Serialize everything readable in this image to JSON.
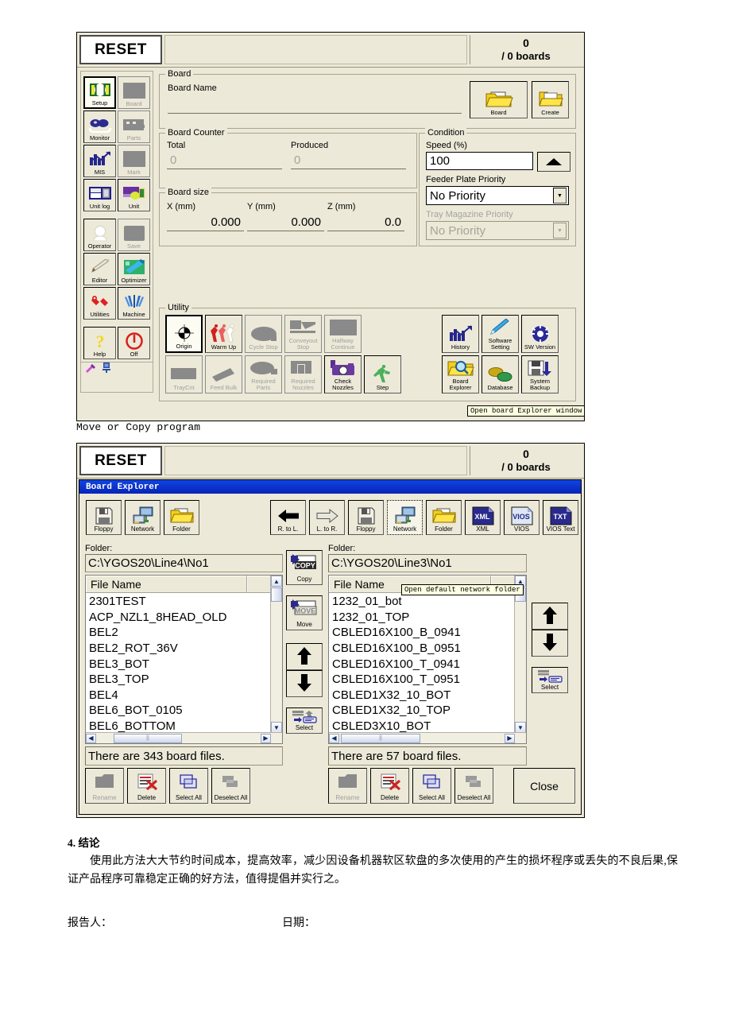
{
  "panel1": {
    "header": {
      "reset": "RESET",
      "count": "0",
      "boards": "/ 0 boards"
    },
    "nav": [
      {
        "label": "Setup",
        "icon": "setup-icon",
        "state": "selected"
      },
      {
        "label": "Board",
        "icon": "board-icon",
        "state": "disabled"
      },
      {
        "label": "Monitor",
        "icon": "monitor-icon",
        "state": "normal"
      },
      {
        "label": "Parts",
        "icon": "parts-icon",
        "state": "disabled"
      },
      {
        "label": "MIS",
        "icon": "mis-chart-icon",
        "state": "normal"
      },
      {
        "label": "Mark",
        "icon": "mark-icon",
        "state": "disabled"
      },
      {
        "label": "Unit log",
        "icon": "unit-log-icon",
        "state": "normal"
      },
      {
        "label": "Unit",
        "icon": "unit-icon",
        "state": "normal"
      },
      {
        "label": "Operator",
        "icon": "operator-icon",
        "state": "normal"
      },
      {
        "label": "Save",
        "icon": "save-icon",
        "state": "disabled"
      },
      {
        "label": "Editor",
        "icon": "editor-pencil-icon",
        "state": "normal"
      },
      {
        "label": "Optimizer",
        "icon": "optimizer-icon",
        "state": "normal"
      },
      {
        "label": "Utilities",
        "icon": "wrench-icon",
        "state": "normal"
      },
      {
        "label": "Machine",
        "icon": "machine-icon",
        "state": "normal"
      },
      {
        "label": "Help",
        "icon": "question-mark-icon",
        "state": "normal"
      },
      {
        "label": "Off",
        "icon": "power-off-icon",
        "state": "normal"
      }
    ],
    "board_group": {
      "caption": "Board",
      "name_label": "Board Name",
      "name_value": "",
      "board_button": "Board",
      "create_button": "Create"
    },
    "board_counter": {
      "caption": "Board Counter",
      "total_label": "Total",
      "total_value": "0",
      "produced_label": "Produced",
      "produced_value": "0"
    },
    "board_size": {
      "caption": "Board size",
      "x_label": "X (mm)",
      "x_value": "0.000",
      "y_label": "Y (mm)",
      "y_value": "0.000",
      "z_label": "Z (mm)",
      "z_value": "0.0"
    },
    "condition": {
      "caption": "Condition",
      "speed_label": "Speed (%)",
      "speed_value": "100",
      "feeder_label": "Feeder Plate Priority",
      "feeder_value": "No Priority",
      "tray_label": "Tray Magazine Priority",
      "tray_value": "No Priority"
    },
    "utility": {
      "caption": "Utility",
      "left_row1": [
        {
          "label": "Origin",
          "icon": "origin-target-icon",
          "state": "selected"
        },
        {
          "label": "Warm Up",
          "icon": "warm-up-runner-icon",
          "state": "normal"
        },
        {
          "label": "Cycle Stop",
          "icon": "cycle-stop-icon",
          "state": "disabled"
        },
        {
          "label": "Conveyout Stop",
          "icon": "conveyout-stop-icon",
          "state": "disabled"
        },
        {
          "label": "Halfway Continue",
          "icon": "halfway-continue-icon",
          "state": "disabled"
        }
      ],
      "left_row2": [
        {
          "label": "TrayCnt",
          "icon": "tray-count-icon",
          "state": "disabled"
        },
        {
          "label": "Feed Bulk",
          "icon": "feed-bulk-icon",
          "state": "disabled"
        },
        {
          "label": "Required Parts",
          "icon": "required-parts-icon",
          "state": "disabled"
        },
        {
          "label": "Required Nozzles",
          "icon": "required-nozzles-icon",
          "state": "disabled"
        },
        {
          "label": "Check Nozzles",
          "icon": "check-nozzles-camera-icon",
          "state": "normal"
        },
        {
          "label": "Step",
          "icon": "step-walker-icon",
          "state": "normal"
        }
      ],
      "right_row1": [
        {
          "label": "History",
          "icon": "history-chart-icon",
          "state": "normal"
        },
        {
          "label": "Software Setting",
          "icon": "software-setting-icon",
          "state": "normal"
        },
        {
          "label": "SW Version",
          "icon": "sw-version-icon",
          "state": "normal"
        }
      ],
      "right_row2": [
        {
          "label": "Board Explorer",
          "icon": "board-explorer-icon",
          "state": "normal"
        },
        {
          "label": "Database",
          "icon": "database-coins-icon",
          "state": "normal"
        },
        {
          "label": "System Backup",
          "icon": "system-backup-icon",
          "state": "normal"
        }
      ]
    },
    "tooltip": "Open board Explorer window"
  },
  "caption_between": "Move or Copy program",
  "panel2": {
    "header": {
      "reset": "RESET",
      "count": "0",
      "boards": "/ 0 boards"
    },
    "dialog_title": "Board Explorer",
    "toolbar_left": [
      {
        "label": "Floppy",
        "icon": "floppy-disk-icon",
        "state": "normal"
      },
      {
        "label": "Network",
        "icon": "network-computer-icon",
        "state": "normal"
      },
      {
        "label": "Folder",
        "icon": "folder-icon",
        "state": "normal"
      }
    ],
    "toolbar_right": [
      {
        "label": "R. to L.",
        "icon": "arrow-left-icon",
        "state": "normal"
      },
      {
        "label": "L. to R.",
        "icon": "arrow-right-outline-icon",
        "state": "normal"
      },
      {
        "label": "Floppy",
        "icon": "floppy-disk-icon",
        "state": "normal"
      },
      {
        "label": "Network",
        "icon": "network-computer-icon",
        "state": "selected"
      },
      {
        "label": "Folder",
        "icon": "folder-icon",
        "state": "normal"
      },
      {
        "label": "XML",
        "icon": "xml-file-icon",
        "state": "normal"
      },
      {
        "label": "VIOS",
        "icon": "vios-file-icon",
        "state": "normal"
      },
      {
        "label": "VIOS Text",
        "icon": "txt-file-icon",
        "state": "normal"
      }
    ],
    "toolbar_tooltip": "Open default network folder",
    "left_pane": {
      "folder_label": "Folder:",
      "folder_path": "C:\\YGOS20\\Line4\\No1",
      "column_header": "File Name",
      "files": [
        "2301TEST",
        "ACP_NZL1_8HEAD_OLD",
        "BEL2",
        "BEL2_ROT_36V",
        "BEL3_BOT",
        "BEL3_TOP",
        "BEL4",
        "BEL6_BOT_0105",
        "BEL6_BOTTOM"
      ],
      "status": "There are 343 board files.",
      "buttons": [
        {
          "label": "Rename",
          "icon": "rename-icon",
          "state": "disabled"
        },
        {
          "label": "Delete",
          "icon": "delete-icon",
          "state": "normal"
        },
        {
          "label": "Select All",
          "icon": "select-all-icon",
          "state": "normal"
        },
        {
          "label": "Deselect All",
          "icon": "deselect-all-icon",
          "state": "normal"
        }
      ],
      "select_button": "Select"
    },
    "right_pane": {
      "folder_label": "Folder:",
      "folder_path": "C:\\YGOS20\\Line3\\No1",
      "column_header": "File Name",
      "files": [
        "1232_01_bot",
        "1232_01_TOP",
        "CBLED16X100_B_0941",
        "CBLED16X100_B_0951",
        "CBLED16X100_T_0941",
        "CBLED16X100_T_0951",
        "CBLED1X32_10_BOT",
        "CBLED1X32_10_TOP",
        "CBLED3X10_BOT"
      ],
      "status": "There are 57 board files.",
      "buttons": [
        {
          "label": "Rename",
          "icon": "rename-icon",
          "state": "disabled"
        },
        {
          "label": "Delete",
          "icon": "delete-icon",
          "state": "normal"
        },
        {
          "label": "Select All",
          "icon": "select-all-icon",
          "state": "normal"
        },
        {
          "label": "Deselect All",
          "icon": "deselect-all-icon",
          "state": "normal"
        }
      ],
      "select_button": "Select"
    },
    "middle_buttons": [
      {
        "label": "Copy",
        "icon": "copy-icon"
      },
      {
        "label": "Move",
        "icon": "move-icon"
      },
      {
        "label": "",
        "icon": "arrow-up-icon"
      },
      {
        "label": "",
        "icon": "arrow-down-icon"
      },
      {
        "label": "Select",
        "icon": "select-icon"
      }
    ],
    "close_button": "Close"
  },
  "document": {
    "heading": "4. 结论",
    "paragraph": "使用此方法大大节约时间成本，提高效率，减少因设备机器软区软盘的多次使用的产生的损坏程序或丢失的不良后果,保证产品程序可靠稳定正确的好方法，值得提倡并实行之。",
    "reporter_label": "报告人：",
    "date_label": "日期："
  }
}
